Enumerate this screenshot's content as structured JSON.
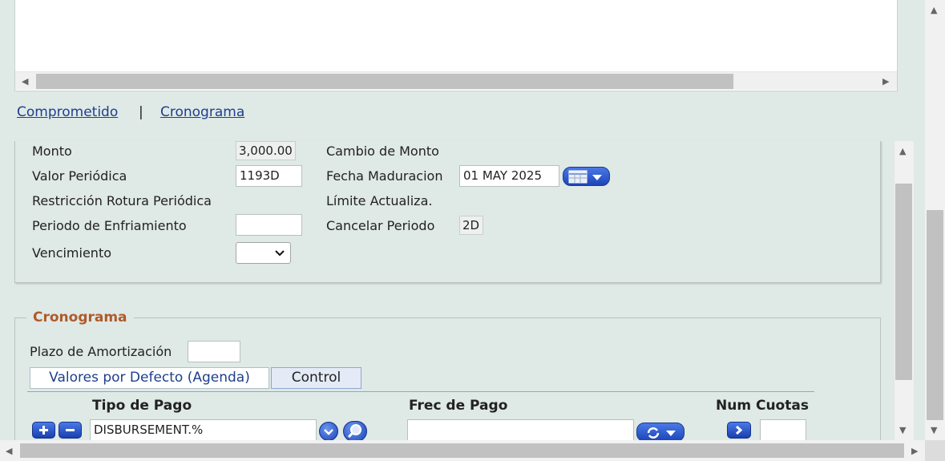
{
  "links": {
    "comprometido": "Comprometido",
    "separator": "|",
    "cronograma": "Cronograma"
  },
  "fields": {
    "monto": {
      "label": "Monto",
      "value": "3,000.00"
    },
    "cambio_monto": {
      "label": "Cambio de Monto"
    },
    "valor_periodica": {
      "label": "Valor Periódica",
      "value": "1193D"
    },
    "fecha_maduracion": {
      "label": "Fecha Maduracion",
      "value": "01 MAY 2025"
    },
    "restriccion": {
      "label": "Restricción Rotura Periódica"
    },
    "limite": {
      "label": "Límite Actualiza."
    },
    "periodo_enfriamiento": {
      "label": "Periodo de Enfriamiento",
      "value": ""
    },
    "cancelar_periodo": {
      "label": "Cancelar Periodo",
      "value": "2D"
    },
    "vencimiento": {
      "label": "Vencimiento",
      "value": ""
    }
  },
  "cronograma": {
    "legend": "Cronograma",
    "plazo_label": "Plazo de Amortización",
    "plazo_value": "",
    "tabs": [
      {
        "label": "Valores por Defecto (Agenda)",
        "active": true
      },
      {
        "label": "Control",
        "active": false
      }
    ],
    "columns": {
      "tipo_pago": "Tipo de Pago",
      "frec_pago": "Frec de Pago",
      "num_cuotas": "Num Cuotas"
    },
    "row": {
      "tipo_pago": "DISBURSEMENT.%",
      "frec_pago": "",
      "num_cuotas": ""
    }
  },
  "icons": {
    "add": "plus-icon",
    "remove": "minus-icon",
    "dropdown": "chevron-down-icon",
    "search": "magnifier-icon",
    "calendar": "calendar-icon",
    "recurrence": "refresh-icon",
    "next": "chevron-right-icon"
  },
  "colors": {
    "background": "#dfe9e6",
    "link": "#1e3f8c",
    "legend": "#b05a2a",
    "button_blue": "#1c45b8"
  }
}
